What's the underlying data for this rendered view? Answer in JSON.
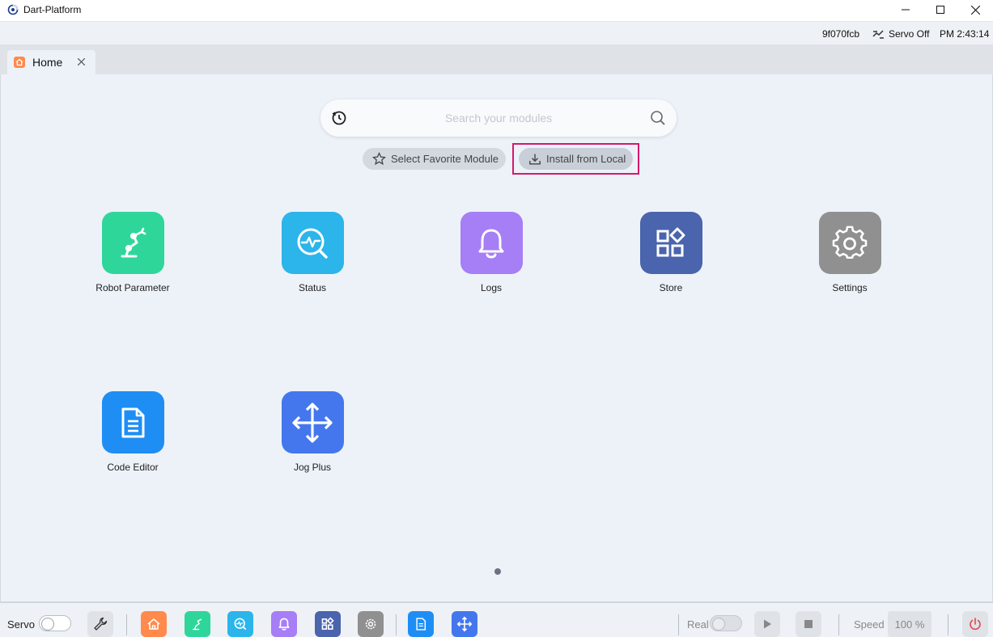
{
  "window": {
    "title": "Dart-Platform",
    "controls": [
      "minimize",
      "maximize",
      "close"
    ]
  },
  "status": {
    "device_id": "9f070fcb",
    "servo_status": "Servo Off",
    "time": "PM 2:43:14"
  },
  "tabs": [
    {
      "label": "Home",
      "icon": "home-icon",
      "active": true
    }
  ],
  "search": {
    "placeholder": "Search your modules",
    "value": ""
  },
  "actions": {
    "favorite_label": "Select Favorite Module",
    "install_label": "Install from Local"
  },
  "modules": [
    {
      "label": "Robot Parameter",
      "icon": "robot-arm-icon",
      "color": "#2fd69a"
    },
    {
      "label": "Status",
      "icon": "status-monitor-icon",
      "color": "#2bb5ea"
    },
    {
      "label": "Logs",
      "icon": "bell-icon",
      "color": "#a67ef5"
    },
    {
      "label": "Store",
      "icon": "store-grid-icon",
      "color": "#4a64ad"
    },
    {
      "label": "Settings",
      "icon": "gear-icon",
      "color": "#909090"
    },
    {
      "label": "Code Editor",
      "icon": "document-icon",
      "color": "#1e8ef5"
    },
    {
      "label": "Jog Plus",
      "icon": "move-arrows-icon",
      "color": "#4477ee"
    }
  ],
  "pagination": {
    "pages": 1,
    "current": 1
  },
  "bottom": {
    "servo_label": "Servo",
    "servo_on": false,
    "real_label": "Real",
    "real_on": false,
    "speed_label": "Speed",
    "speed_value": "100 %",
    "quick_launch": [
      "home-icon",
      "robot-arm-icon",
      "status-monitor-icon",
      "bell-icon",
      "store-grid-icon",
      "gear-icon",
      "document-icon",
      "move-arrows-icon"
    ],
    "quick_colors": [
      "#ff8a4c",
      "#2fd69a",
      "#2bb5ea",
      "#a67ef5",
      "#4a64ad",
      "#909090",
      "#1e8ef5",
      "#4477ee"
    ]
  }
}
